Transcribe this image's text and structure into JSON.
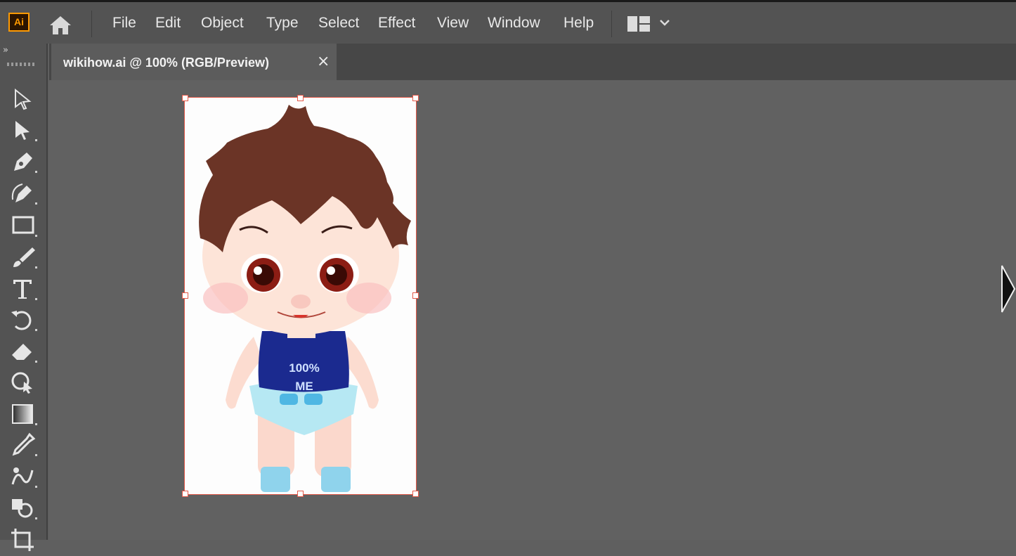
{
  "app": {
    "logo_text": "Ai",
    "brand_color": "#ff9a00"
  },
  "menu": {
    "items": [
      "File",
      "Edit",
      "Object",
      "Type",
      "Select",
      "Effect",
      "View",
      "Window",
      "Help"
    ]
  },
  "toolbar": {
    "collapse_label": "»",
    "tools": [
      "selection-tool-icon",
      "direct-selection-tool-icon",
      "pen-tool-icon",
      "curvature-tool-icon",
      "rectangle-tool-icon",
      "paintbrush-tool-icon",
      "type-tool-icon",
      "rotate-tool-icon",
      "eraser-tool-icon",
      "shape-builder-tool-icon",
      "gradient-tool-icon",
      "eyedropper-tool-icon",
      "blend-tool-icon",
      "symbol-sprayer-tool-icon",
      "artboard-tool-icon"
    ]
  },
  "document": {
    "tab_title": "wikihow.ai @ 100% (RGB/Preview)",
    "close_label": "×"
  },
  "artwork": {
    "shirt_text_line1": "100%",
    "shirt_text_line2": "ME",
    "colors": {
      "hair": "#6b3426",
      "skin": "#fde4d8",
      "shirt": "#1b2a8f",
      "diaper": "#b6e8f3",
      "socks": "#8fd3ec",
      "selection": "#e35a4a"
    }
  }
}
